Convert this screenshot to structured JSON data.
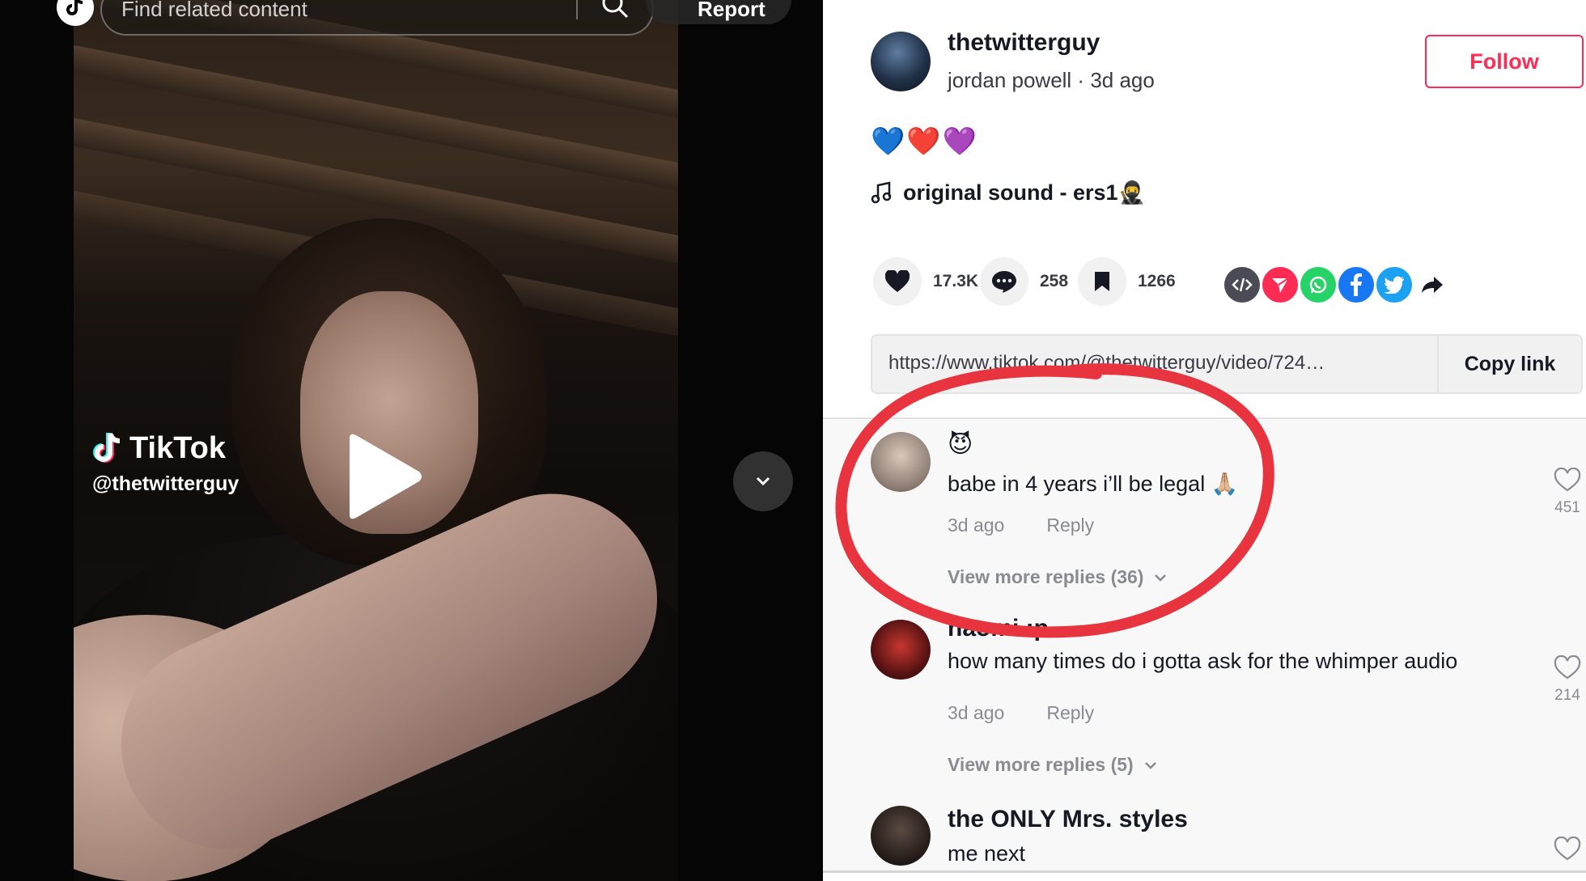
{
  "player": {
    "search_placeholder": "Find related content",
    "report_label": "Report",
    "watermark_brand": "TikTok",
    "watermark_handle": "@thetwitterguy"
  },
  "author": {
    "username": "thetwitterguy",
    "subline": "jordan powell · 3d ago",
    "follow_label": "Follow"
  },
  "post": {
    "caption": "💙❤️💜",
    "music": "original sound - ers1🥷"
  },
  "actions": {
    "likes": "17.3K",
    "comments": "258",
    "saves": "1266",
    "share_icons": [
      "embed-icon",
      "send-icon",
      "whatsapp-icon",
      "facebook-icon",
      "twitter-icon",
      "share-arrow-icon"
    ]
  },
  "link": {
    "url": "https://www.tiktok.com/@thetwitterguy/video/7243914...",
    "copy_label": "Copy link"
  },
  "comments": [
    {
      "name": "😈",
      "text": "babe in 4 years i’ll be legal 🙏🏼",
      "time": "3d ago",
      "reply": "Reply",
      "likes": "451",
      "more_replies": "View more replies (36)"
    },
    {
      "name": "naomi :p",
      "text": "how many times do i gotta ask for the whimper audio",
      "time": "3d ago",
      "reply": "Reply",
      "likes": "214",
      "more_replies": "View more replies (5)"
    },
    {
      "name": "the ONLY Mrs. styles",
      "text": "me next"
    }
  ],
  "colors": {
    "accent": "#fe2c55",
    "annotation": "#e8343f",
    "text_primary": "#161823",
    "text_secondary": "#8a8b91"
  }
}
